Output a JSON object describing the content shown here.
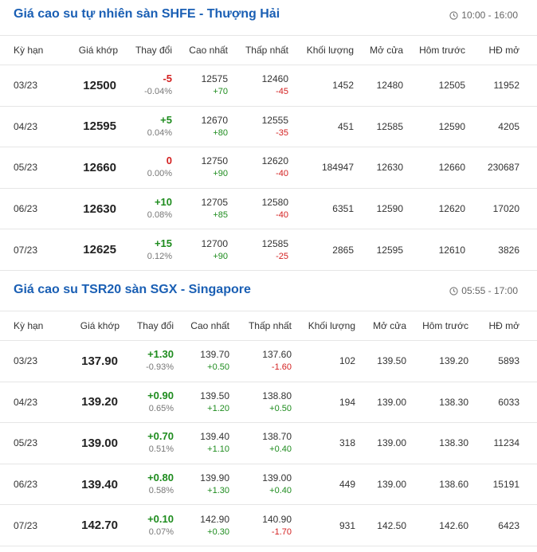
{
  "sections": [
    {
      "title": "Giá cao su tự nhiên sàn SHFE - Thượng Hải",
      "time": "10:00 - 16:00",
      "headers": [
        "Kỳ hạn",
        "Giá khớp",
        "Thay đổi",
        "Cao nhất",
        "Thấp nhất",
        "Khối lượng",
        "Mở cửa",
        "Hôm trước",
        "HĐ mở"
      ],
      "rows": [
        {
          "term": "03/23",
          "price": "12500",
          "change": "-5",
          "change_pct": "-0.04%",
          "dir": "down",
          "high": "12575",
          "high_chg": "+70",
          "low": "12460",
          "low_chg": "-45",
          "volume": "1452",
          "open": "12480",
          "prev": "12505",
          "oi": "11952"
        },
        {
          "term": "04/23",
          "price": "12595",
          "change": "+5",
          "change_pct": "0.04%",
          "dir": "up",
          "high": "12670",
          "high_chg": "+80",
          "low": "12555",
          "low_chg": "-35",
          "volume": "451",
          "open": "12585",
          "prev": "12590",
          "oi": "4205"
        },
        {
          "term": "05/23",
          "price": "12660",
          "change": "0",
          "change_pct": "0.00%",
          "dir": "flat",
          "high": "12750",
          "high_chg": "+90",
          "low": "12620",
          "low_chg": "-40",
          "volume": "184947",
          "open": "12630",
          "prev": "12660",
          "oi": "230687"
        },
        {
          "term": "06/23",
          "price": "12630",
          "change": "+10",
          "change_pct": "0.08%",
          "dir": "up",
          "high": "12705",
          "high_chg": "+85",
          "low": "12580",
          "low_chg": "-40",
          "volume": "6351",
          "open": "12590",
          "prev": "12620",
          "oi": "17020"
        },
        {
          "term": "07/23",
          "price": "12625",
          "change": "+15",
          "change_pct": "0.12%",
          "dir": "up",
          "high": "12700",
          "high_chg": "+90",
          "low": "12585",
          "low_chg": "-25",
          "volume": "2865",
          "open": "12595",
          "prev": "12610",
          "oi": "3826"
        }
      ]
    },
    {
      "title": "Giá cao su TSR20 sàn SGX - Singapore",
      "time": "05:55 - 17:00",
      "headers": [
        "Kỳ hạn",
        "Giá khớp",
        "Thay đổi",
        "Cao nhất",
        "Thấp nhất",
        "Khối lượng",
        "Mở cửa",
        "Hôm trước",
        "HĐ mở"
      ],
      "rows": [
        {
          "term": "03/23",
          "price": "137.90",
          "change": "+1.30",
          "change_pct": "-0.93%",
          "dir": "up",
          "high": "139.70",
          "high_chg": "+0.50",
          "low": "137.60",
          "low_chg": "-1.60",
          "volume": "102",
          "open": "139.50",
          "prev": "139.20",
          "oi": "5893"
        },
        {
          "term": "04/23",
          "price": "139.20",
          "change": "+0.90",
          "change_pct": "0.65%",
          "dir": "up",
          "high": "139.50",
          "high_chg": "+1.20",
          "low": "138.80",
          "low_chg": "+0.50",
          "volume": "194",
          "open": "139.00",
          "prev": "138.30",
          "oi": "6033"
        },
        {
          "term": "05/23",
          "price": "139.00",
          "change": "+0.70",
          "change_pct": "0.51%",
          "dir": "up",
          "high": "139.40",
          "high_chg": "+1.10",
          "low": "138.70",
          "low_chg": "+0.40",
          "volume": "318",
          "open": "139.00",
          "prev": "138.30",
          "oi": "11234"
        },
        {
          "term": "06/23",
          "price": "139.40",
          "change": "+0.80",
          "change_pct": "0.58%",
          "dir": "up",
          "high": "139.90",
          "high_chg": "+1.30",
          "low": "139.00",
          "low_chg": "+0.40",
          "volume": "449",
          "open": "139.00",
          "prev": "138.60",
          "oi": "15191"
        },
        {
          "term": "07/23",
          "price": "142.70",
          "change": "+0.10",
          "change_pct": "0.07%",
          "dir": "up",
          "high": "142.90",
          "high_chg": "+0.30",
          "low": "140.90",
          "low_chg": "-1.70",
          "volume": "931",
          "open": "142.50",
          "prev": "142.60",
          "oi": "6423"
        }
      ]
    }
  ],
  "colors": {
    "title": "#1a5fb4",
    "up": "#1e8c1e",
    "down": "#d31f1f"
  },
  "icons": {
    "time": "clock-icon"
  }
}
